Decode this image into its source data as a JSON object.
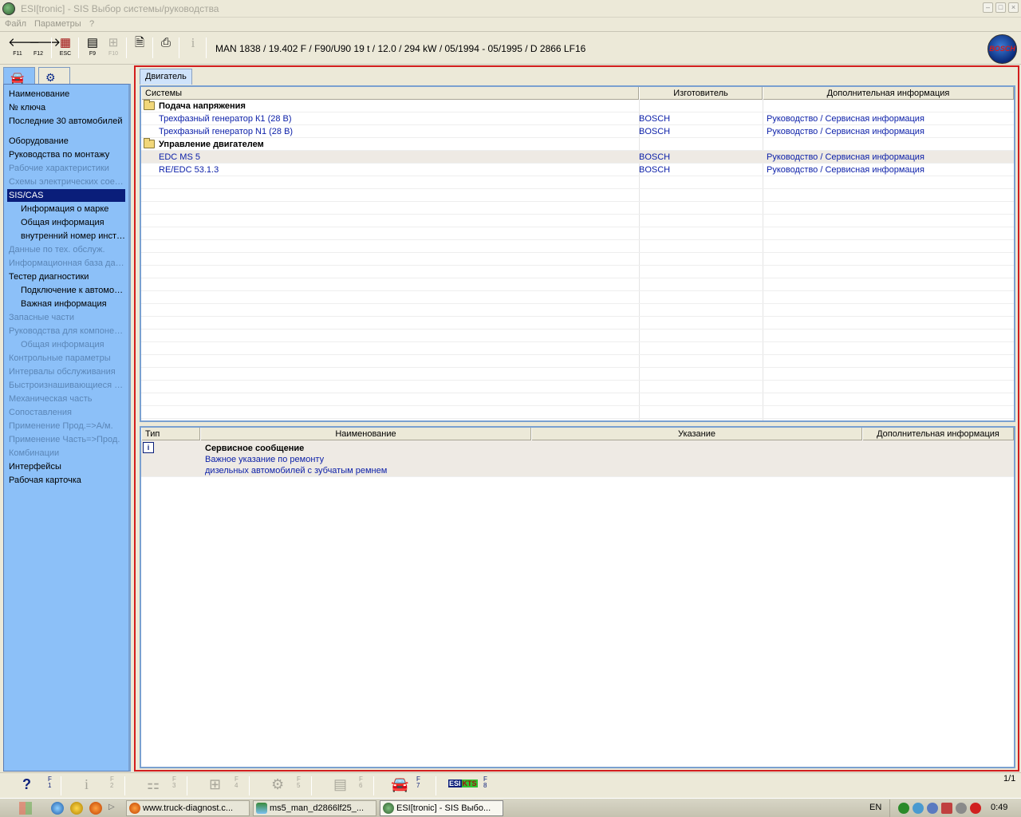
{
  "window": {
    "title": "ESI[tronic] - SIS Выбор системы/руководства",
    "min": "–",
    "max": "□",
    "close": "×"
  },
  "menu": [
    "Файл",
    "Параметры",
    "?"
  ],
  "toolbar": {
    "back_key": "F11",
    "forward_key": "F12",
    "esc_key": "ESC",
    "f9_key": "F9",
    "f10_key": "F10",
    "info_glyph": "i",
    "vehicle": "MAN 1838 / 19.402 F / F90/U90 19 t / 12.0 / 294 kW / 05/1994 - 05/1995 / D 2866 LF16",
    "logo": "BOSCH"
  },
  "nav": [
    {
      "label": "Наименование",
      "state": "normal"
    },
    {
      "label": "№ ключа",
      "state": "normal"
    },
    {
      "label": "Последние 30 автомобилей",
      "state": "normal"
    },
    {
      "label": "Оборудование",
      "state": "normal"
    },
    {
      "label": "Руководства по монтажу",
      "state": "normal"
    },
    {
      "label": "Рабочие характеристики",
      "state": "disabled"
    },
    {
      "label": "Схемы электрических соединений",
      "state": "disabled"
    },
    {
      "label": "SIS/CAS",
      "state": "selected"
    },
    {
      "label": "Информация о марке",
      "state": "normal"
    },
    {
      "label": "Общая информация",
      "state": "normal"
    },
    {
      "label": "внутренний номер инструкции",
      "state": "normal"
    },
    {
      "label": "Данные по тех. обслуж.",
      "state": "disabled"
    },
    {
      "label": "Информационная база данных",
      "state": "disabled"
    },
    {
      "label": "Тестер диагностики",
      "state": "normal"
    },
    {
      "label": "Подключение к автомобилю",
      "state": "normal"
    },
    {
      "label": "Важная информация",
      "state": "normal"
    },
    {
      "label": "Запасные части",
      "state": "disabled"
    },
    {
      "label": "Руководства для компонентов",
      "state": "disabled"
    },
    {
      "label": "Общая информация",
      "state": "disabled"
    },
    {
      "label": "Контрольные параметры",
      "state": "disabled"
    },
    {
      "label": "Интервалы обслуживания",
      "state": "disabled"
    },
    {
      "label": "Быстроизнашивающиеся детали",
      "state": "disabled"
    },
    {
      "label": "Механическая часть",
      "state": "disabled"
    },
    {
      "label": "Сопоставления",
      "state": "disabled"
    },
    {
      "label": "Применение Прод.=>А/м.",
      "state": "disabled"
    },
    {
      "label": "Применение Часть=>Прод.",
      "state": "disabled"
    },
    {
      "label": "Комбинации",
      "state": "disabled"
    },
    {
      "label": "Интерфейсы",
      "state": "normal"
    },
    {
      "label": "Рабочая карточка",
      "state": "normal"
    }
  ],
  "main": {
    "tab": "Двигатель",
    "systems_headers": [
      "Системы",
      "Изготовитель",
      "Дополнительная информация"
    ],
    "groups": [
      {
        "name": "Подача напряжения"
      },
      {
        "name": "Управление двигателем"
      }
    ],
    "systems": [
      {
        "system": "Трехфазный генератор К1 (28 В)",
        "maker": "BOSCH",
        "info": "Руководство / Сервисная информация"
      },
      {
        "system": "Трехфазный генератор N1 (28 В)",
        "maker": "BOSCH",
        "info": "Руководство / Сервисная информация"
      },
      {
        "system": "EDC MS 5",
        "maker": "BOSCH",
        "info": "Руководство / Сервисная информация"
      },
      {
        "system": "RE/EDC 53.1.3",
        "maker": "BOSCH",
        "info": "Руководство / Сервисная информация"
      }
    ],
    "docs_headers": [
      "Тип",
      "Наименование",
      "Указание",
      "Дополнительная информация"
    ],
    "doc": {
      "type_icon": "i",
      "title": "Сервисное сообщение",
      "line1": "Важное указание по ремонту",
      "line2": "дизельных автомобилей с зубчатым ремнем"
    }
  },
  "fbar": {
    "keys": [
      "1",
      "2",
      "3",
      "4",
      "5",
      "6",
      "7",
      "8"
    ],
    "f": "F",
    "esi": "ESI",
    "kts": "KTS",
    "page": "1/1"
  },
  "taskbar": {
    "tasks": [
      "www.truck-diagnost.c...",
      "ms5_man_d2866lf25_...",
      "ESI[tronic] - SIS Выбо..."
    ],
    "lang": "EN",
    "clock": "0:49"
  },
  "colors": {
    "accent": "#0a1e7a",
    "nav_bg": "#8cc0f8",
    "frame": "#d21d1d"
  }
}
